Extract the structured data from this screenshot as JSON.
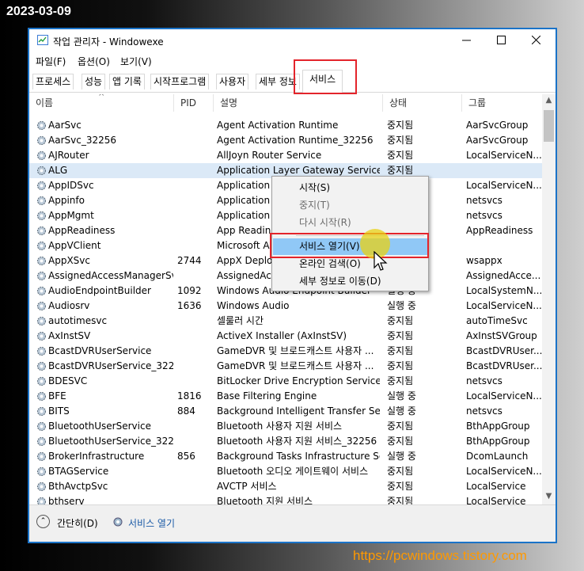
{
  "overlay": {
    "date": "2023-03-09",
    "site_url": "https://pcwindows.tistory.com"
  },
  "window": {
    "title": "작업 관리자   - Windowexe",
    "menu": [
      "파일(F)",
      "옵션(O)",
      "보기(V)"
    ],
    "tabs": [
      "프로세스",
      "성능",
      "앱 기록",
      "시작프로그램",
      "사용자",
      "세부 정보",
      "서비스"
    ],
    "active_tab": "서비스",
    "columns": [
      "이름",
      "PID",
      "설명",
      "상태",
      "그룹"
    ],
    "rows": [
      [
        "AarSvc",
        "",
        "Agent Activation Runtime",
        "중지됨",
        "AarSvcGroup"
      ],
      [
        "AarSvc_32256",
        "",
        "Agent Activation Runtime_32256",
        "중지됨",
        "AarSvcGroup"
      ],
      [
        "AJRouter",
        "",
        "AllJoyn Router Service",
        "중지됨",
        "LocalServiceN..."
      ],
      [
        "ALG",
        "",
        "Application Layer Gateway Service",
        "중지됨",
        ""
      ],
      [
        "AppIDSvc",
        "",
        "Application",
        "",
        "LocalServiceN..."
      ],
      [
        "Appinfo",
        "",
        "Application",
        "",
        "netsvcs"
      ],
      [
        "AppMgmt",
        "",
        "Application",
        "",
        "netsvcs"
      ],
      [
        "AppReadiness",
        "",
        "App Readine",
        "",
        "AppReadiness"
      ],
      [
        "AppVClient",
        "",
        "Microsoft A",
        "",
        ""
      ],
      [
        "AppXSvc",
        "2744",
        "AppX Deplo",
        "",
        "wsappx"
      ],
      [
        "AssignedAccessManagerSvc",
        "",
        "AssignedAcc",
        "",
        "AssignedAcce..."
      ],
      [
        "AudioEndpointBuilder",
        "1092",
        "Windows Audio Endpoint Builder",
        "실행 중",
        "LocalSystemN..."
      ],
      [
        "Audiosrv",
        "1636",
        "Windows Audio",
        "실행 중",
        "LocalServiceN..."
      ],
      [
        "autotimesvc",
        "",
        "셀룰러 시간",
        "중지됨",
        "autoTimeSvc"
      ],
      [
        "AxInstSV",
        "",
        "ActiveX Installer (AxInstSV)",
        "중지됨",
        "AxInstSVGroup"
      ],
      [
        "BcastDVRUserService",
        "",
        "GameDVR 및 브로드캐스트 사용자 ...",
        "중지됨",
        "BcastDVRUser..."
      ],
      [
        "BcastDVRUserService_32256",
        "",
        "GameDVR 및 브로드캐스트 사용자 ...",
        "중지됨",
        "BcastDVRUser..."
      ],
      [
        "BDESVC",
        "",
        "BitLocker Drive Encryption Service",
        "중지됨",
        "netsvcs"
      ],
      [
        "BFE",
        "1816",
        "Base Filtering Engine",
        "실행 중",
        "LocalServiceN..."
      ],
      [
        "BITS",
        "884",
        "Background Intelligent Transfer Ser...",
        "실행 중",
        "netsvcs"
      ],
      [
        "BluetoothUserService",
        "",
        "Bluetooth 사용자 지원 서비스",
        "중지됨",
        "BthAppGroup"
      ],
      [
        "BluetoothUserService_32256",
        "",
        "Bluetooth 사용자 지원 서비스_32256",
        "중지됨",
        "BthAppGroup"
      ],
      [
        "BrokerInfrastructure",
        "856",
        "Background Tasks Infrastructure Ser...",
        "실행 중",
        "DcomLaunch"
      ],
      [
        "BTAGService",
        "",
        "Bluetooth 오디오 게이트웨이 서비스",
        "중지됨",
        "LocalServiceN..."
      ],
      [
        "BthAvctpSvc",
        "",
        "AVCTP 서비스",
        "중지됨",
        "LocalService"
      ],
      [
        "bthserv",
        "",
        "Bluetooth 지원 서비스",
        "중지됨",
        "LocalService"
      ]
    ],
    "selected_row": 3,
    "context_menu": {
      "start": "시작(S)",
      "stop": "중지(T)",
      "restart": "다시 시작(R)",
      "open_services": "서비스 열기(V)",
      "search_online": "온라인 검색(O)",
      "go_to_details": "세부 정보로 이동(D)"
    },
    "footer": {
      "fewer_details": "간단히(D)",
      "open_services": "서비스 열기"
    }
  },
  "colors": {
    "window_border": "#1a73c8",
    "highlight_red": "#e3242b",
    "selected_row": "#dbe9f7",
    "menu_hover": "#90c8f6",
    "link_blue": "#1a5aa6",
    "url_orange": "#ff9900",
    "cursor_yellow": "#e8d214"
  },
  "icons": [
    "gear-icon",
    "task-manager-icon",
    "minimize-icon",
    "maximize-icon",
    "close-icon",
    "chevron-up-icon",
    "mouse-cursor-icon"
  ]
}
